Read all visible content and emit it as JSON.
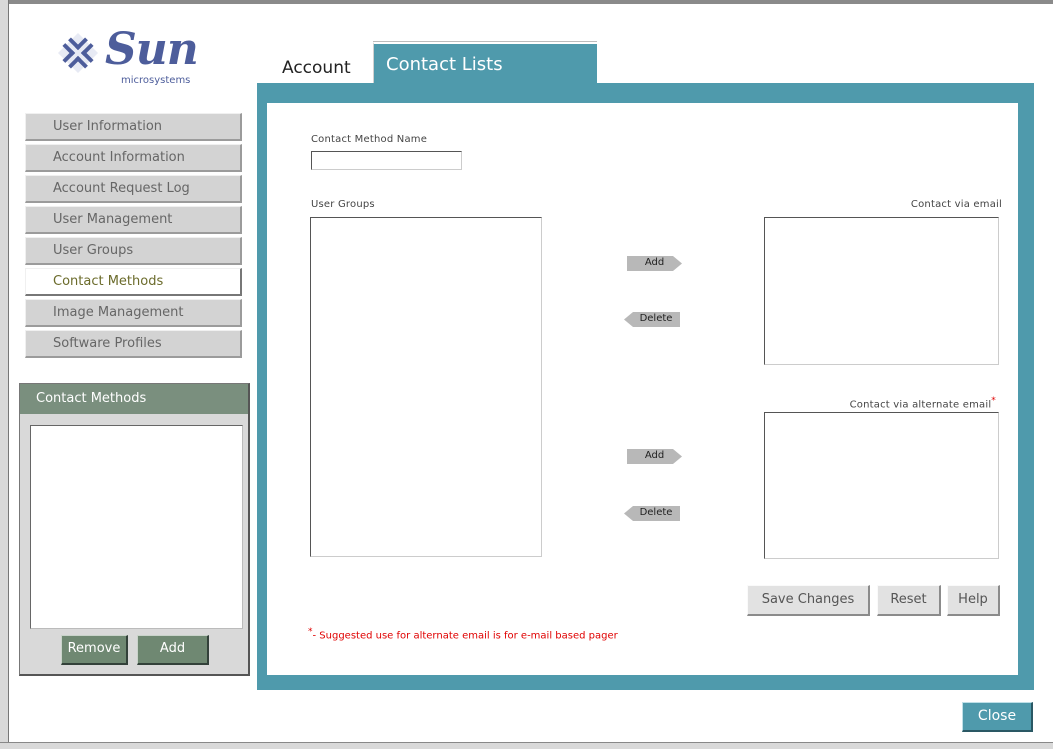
{
  "brand": {
    "name": "Sun",
    "sub": "microsystems"
  },
  "nav": {
    "items": [
      {
        "label": "User Information"
      },
      {
        "label": "Account Information"
      },
      {
        "label": "Account Request Log"
      },
      {
        "label": "User Management"
      },
      {
        "label": "User Groups"
      },
      {
        "label": "Contact Methods",
        "active": true
      },
      {
        "label": "Image Management"
      },
      {
        "label": "Software Profiles"
      }
    ]
  },
  "contact_methods_panel": {
    "title": "Contact Methods",
    "remove_label": "Remove",
    "add_label": "Add"
  },
  "tabs": {
    "account": "Account",
    "contact_lists": "Contact Lists"
  },
  "form": {
    "name_label": "Contact Method Name",
    "name_value": "",
    "user_groups_label": "User Groups",
    "email_label": "Contact via email",
    "alt_email_label": "Contact via alternate email",
    "add_label": "Add",
    "delete_label": "Delete",
    "save_label": "Save Changes",
    "reset_label": "Reset",
    "help_label": "Help",
    "note_marker": "*",
    "note_text": "- Suggested use for alternate email is for e-mail based pager"
  },
  "footer": {
    "close_label": "Close"
  },
  "colors": {
    "teal": "#4f9aac",
    "panel_green": "#6f8872",
    "required": "#e00000"
  }
}
